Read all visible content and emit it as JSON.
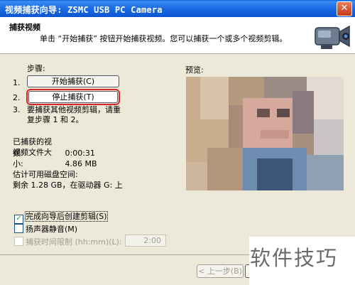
{
  "window": {
    "title": "视频捕获向导: ZSMC USB PC Camera",
    "close": "✕"
  },
  "header": {
    "title": "捕获视频",
    "description": "单击 “开始捕获” 按钮开始捕获视频。您可以捕获一个或多个视频剪辑。",
    "icon": "video-camera-icon"
  },
  "steps": {
    "label": "步骤:",
    "n1": "1.",
    "n2": "2.",
    "n3": "3.",
    "start_button": "开始捕获(C)",
    "stop_button": "停止捕获(T)",
    "step3_text": "要捕获其他视频剪辑，请重复步骤 1 和 2。"
  },
  "stats": {
    "captured_label": "已捕获的视频:",
    "captured_value": "0:00:31",
    "size_label": "视频文件大小:",
    "size_value": "4.86 MB",
    "disk_label": "估计可用磁盘空间:",
    "disk_value": "剩余 1.28 GB，在驱动器 G: 上"
  },
  "preview": {
    "label": "预览:"
  },
  "options": {
    "create_clips": "完成向导后创建剪辑(S)",
    "create_clips_checked": true,
    "mute": "扬声器静音(M)",
    "mute_checked": false,
    "time_limit": "捕获时间限制 (hh:mm)(L):",
    "time_limit_checked": false,
    "time_value": "2:00"
  },
  "footer": {
    "back_button": "< 上一步(B)"
  },
  "watermark": "软件技巧",
  "colors": {
    "highlight": "#d9262a",
    "titlebar": "#0b55d0"
  }
}
